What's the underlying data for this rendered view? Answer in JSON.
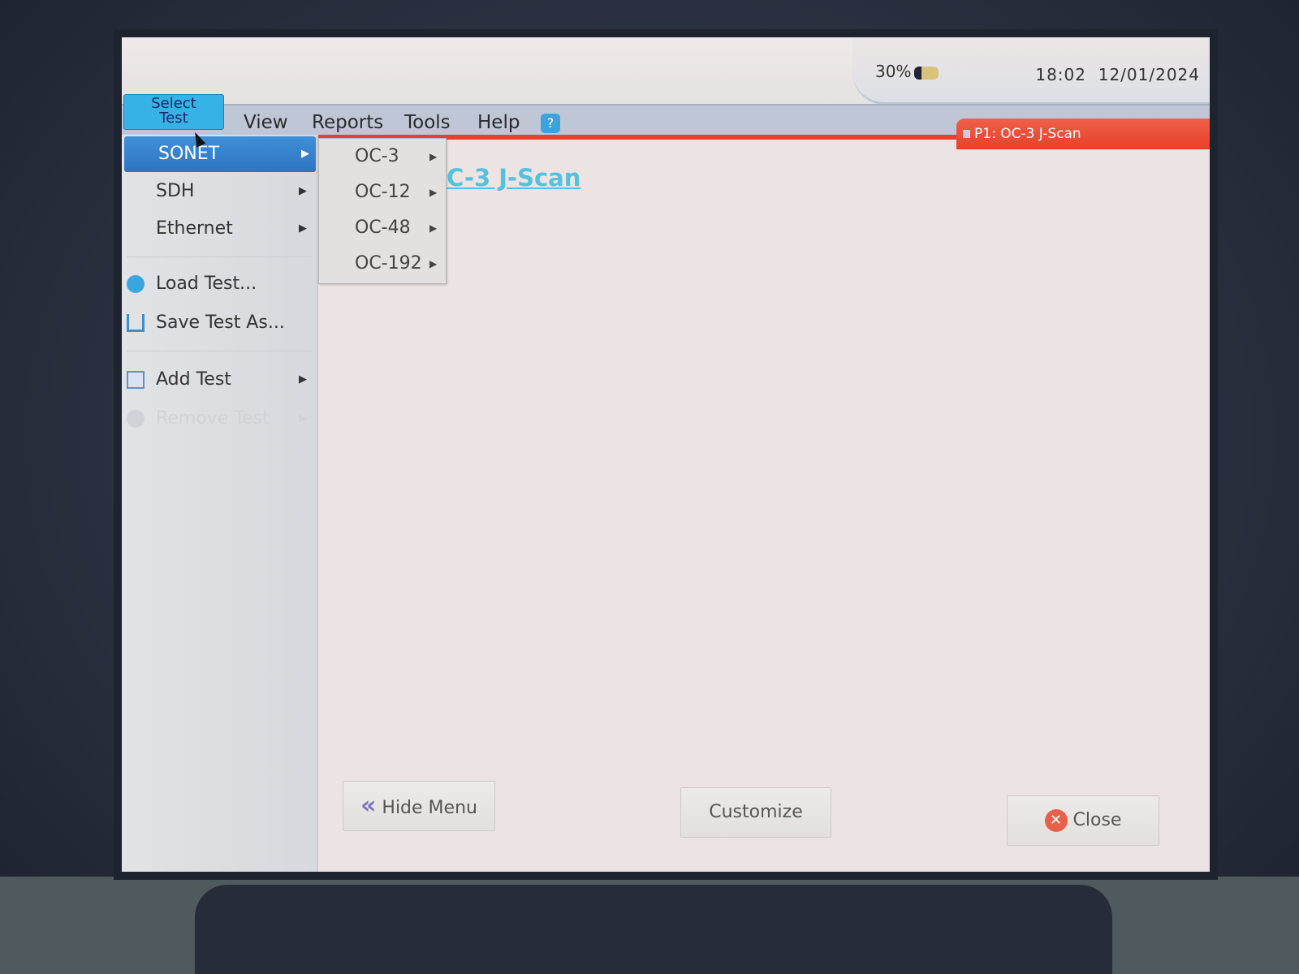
{
  "status": {
    "battery": "30%",
    "time": "18:02",
    "date": "12/01/2024"
  },
  "menubar": {
    "select_test_line1": "Select",
    "select_test_line2": "Test",
    "items": [
      "View",
      "Reports",
      "Tools",
      "Help"
    ],
    "help_icon": "help-question-icon"
  },
  "tab": {
    "label": "P1: OC-3 J-Scan"
  },
  "main": {
    "link_text": "C-3 J-Scan"
  },
  "menu": {
    "items": [
      {
        "label": "SONET",
        "submenu": true,
        "active": true
      },
      {
        "label": "SDH",
        "submenu": true
      },
      {
        "label": "Ethernet",
        "submenu": true
      },
      {
        "label": "Load Test...",
        "icon": "gear-icon"
      },
      {
        "label": "Save Test As...",
        "icon": "save-icon"
      },
      {
        "label": "Add Test",
        "icon": "add-test-icon",
        "submenu": true
      },
      {
        "label": "Remove Test",
        "icon": "remove-icon",
        "submenu": true,
        "disabled": true
      }
    ],
    "arrow": "▶"
  },
  "submenu": {
    "items": [
      "OC-3",
      "OC-12",
      "OC-48",
      "OC-192"
    ]
  },
  "buttons": {
    "hide_menu": "Hide Menu",
    "customize": "Customize",
    "close": "Close"
  },
  "colors": {
    "accent_red": "#e8432a",
    "select_blue": "#37b2e6",
    "active_blue": "#2f74c2"
  }
}
